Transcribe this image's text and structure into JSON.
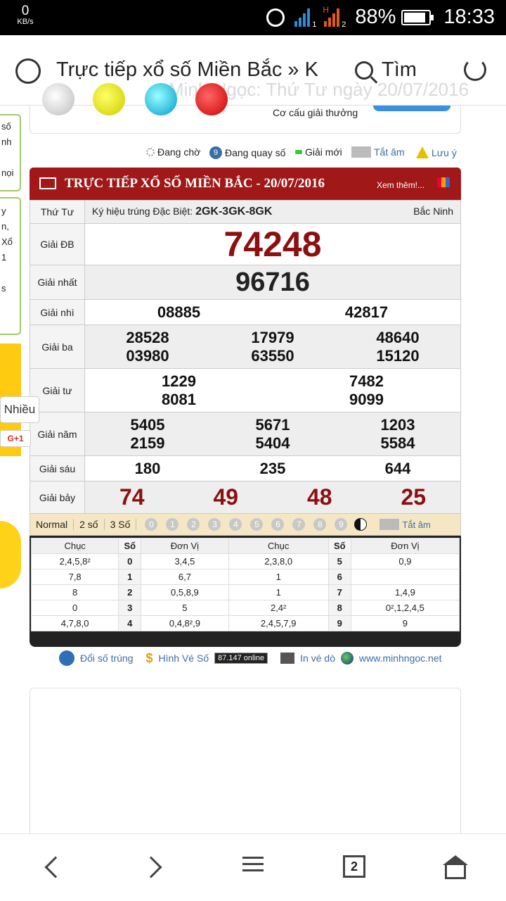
{
  "status_bar": {
    "speed_value": "0",
    "speed_unit": "KB/s",
    "battery": "88%",
    "time": "18:33",
    "sim1": "1",
    "sim2": "2",
    "net_type": "H"
  },
  "browser": {
    "tab_title": "Trực tiếp xổ số Miền Bắc » K",
    "search_label": "Tìm",
    "ghost_text": "Minh Ngọc: Thứ Tư ngày 20/07/2016"
  },
  "top_box": {
    "cc_text": "Cơ cấu giải thưởng"
  },
  "side_left": {
    "lines_a": [
      "số",
      "nh",
      "",
      "nọi"
    ],
    "lines_b": [
      "y",
      "n,",
      "Xổ",
      "1",
      "",
      "s"
    ]
  },
  "legend": {
    "dang_cho": "Đang chờ",
    "dang_quay": "Đang quay số",
    "giai_moi": "Giải mới",
    "tat_am": "Tắt âm",
    "luu_y": "Lưu ý",
    "nine": "9"
  },
  "result": {
    "title": "TRỰC TIẾP XỔ SỐ MIỀN BẮC - 20/07/2016",
    "more": "Xem thêm!...",
    "weekday": "Thứ Tư",
    "symbol_label": "Ký hiệu trúng Đặc Biệt:",
    "symbol_value": "2GK-3GK-8GK",
    "province": "Bắc Ninh",
    "prizes": {
      "db_label": "Giải ĐB",
      "db": "74248",
      "nhat_label": "Giải nhất",
      "nhat": "96716",
      "nhi_label": "Giải nhì",
      "nhi": [
        "08885",
        "42817"
      ],
      "ba_label": "Giải ba",
      "ba": [
        "28528",
        "17979",
        "48640",
        "03980",
        "63550",
        "15120"
      ],
      "tu_label": "Giải tư",
      "tu": [
        "1229",
        "7482",
        "8081",
        "9099"
      ],
      "nam_label": "Giải năm",
      "nam": [
        "5405",
        "5671",
        "1203",
        "2159",
        "5404",
        "5584"
      ],
      "sau_label": "Giải sáu",
      "sau": [
        "180",
        "235",
        "644"
      ],
      "bay_label": "Giải bảy",
      "bay": [
        "74",
        "49",
        "48",
        "25"
      ]
    }
  },
  "toolbar": {
    "normal": "Normal",
    "two": "2 số",
    "three": "3 Số",
    "digits": [
      "0",
      "1",
      "2",
      "3",
      "4",
      "5",
      "6",
      "7",
      "8",
      "9"
    ],
    "tat_am": "Tắt âm"
  },
  "stats": {
    "headers": [
      "Chục",
      "Số",
      "Đơn Vị",
      "Chục",
      "Số",
      "Đơn Vị"
    ],
    "rows": [
      [
        "2,4,5,8²",
        "0",
        "3,4,5",
        "2,3,8,0",
        "5",
        "0,9"
      ],
      [
        "7,8",
        "1",
        "6,7",
        "1",
        "6",
        ""
      ],
      [
        "8",
        "2",
        "0,5,8,9",
        "1",
        "7",
        "1,4,9"
      ],
      [
        "0",
        "3",
        "5",
        "2,4²",
        "8",
        "0²,1,2,4,5"
      ],
      [
        "4,7,8,0",
        "4",
        "0,4,8²,9",
        "2,4,5,7,9",
        "9",
        "9"
      ]
    ]
  },
  "footer": {
    "doi_so": "Đổi số trúng",
    "hinh_ve": "Hình Vé Số",
    "online": "87.147 online",
    "in_ve": "In vé dò",
    "site": "www.minhngoc.net"
  },
  "overlay": {
    "nhieu": "Nhiều",
    "gplus": "G+1"
  },
  "nav": {
    "tabs_count": "2"
  }
}
